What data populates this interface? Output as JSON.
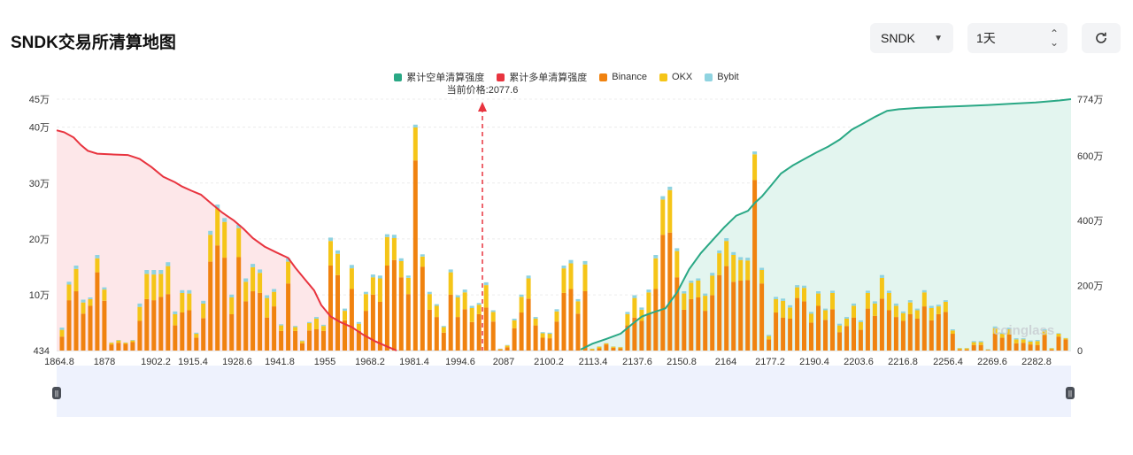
{
  "header": {
    "title": "SNDK交易所清算地图"
  },
  "controls": {
    "symbol": "SNDK",
    "interval": "1天",
    "symbol_icon": "chevron-down-icon",
    "interval_icon": "up-down-icon",
    "refresh_icon": "refresh-icon"
  },
  "colors": {
    "short_cum": "#2aa885",
    "long_cum": "#e8343f",
    "binance": "#f0820f",
    "okx": "#f5c518",
    "bybit": "#8fd3e0",
    "short_fill": "#e3f5ef",
    "long_fill": "#fde7e9"
  },
  "chart_data": {
    "type": "bar",
    "legend": [
      {
        "label": "累计空单清算强度",
        "color": "#2aa885"
      },
      {
        "label": "累计多单清算强度",
        "color": "#e8343f"
      },
      {
        "label": "Binance",
        "color": "#f0820f"
      },
      {
        "label": "OKX",
        "color": "#f5c518"
      },
      {
        "label": "Bybit",
        "color": "#8fd3e0"
      }
    ],
    "current_price_label": "当前价格:2077.6",
    "current_price": 2077.6,
    "watermark": "coinglass",
    "x_ticks": [
      "1864.8",
      "1878",
      "1902.2",
      "1915.4",
      "1928.6",
      "1941.8",
      "1955",
      "1968.2",
      "1981.4",
      "1994.6",
      "2087",
      "2100.2",
      "2113.4",
      "2137.6",
      "2150.8",
      "2164",
      "2177.2",
      "2190.4",
      "2203.6",
      "2216.8",
      "2256.4",
      "2269.6",
      "2282.8"
    ],
    "y_left_ticks": [
      "434",
      "10万",
      "20万",
      "30万",
      "40万",
      "45万"
    ],
    "y_left_values": [
      434,
      100000,
      200000,
      300000,
      400000,
      450000
    ],
    "y_right_ticks": [
      "0",
      "200万",
      "400万",
      "600万",
      "774万"
    ],
    "y_right_values": [
      0,
      2000000,
      4000000,
      6000000,
      7740000
    ],
    "y_left_range": [
      434,
      450000
    ],
    "y_right_range": [
      0,
      7740000
    ],
    "bars": {
      "binance": [
        25000,
        90000,
        106000,
        66000,
        80000,
        140000,
        89000,
        11000,
        14000,
        12000,
        15000,
        53000,
        92000,
        90000,
        96000,
        101000,
        45000,
        68000,
        72000,
        23000,
        58000,
        159000,
        188000,
        166000,
        65000,
        167000,
        88000,
        106000,
        103000,
        59000,
        79000,
        35000,
        120000,
        35000,
        13000,
        36000,
        38000,
        35000,
        152000,
        135000,
        54000,
        110000,
        35000,
        71000,
        100000,
        87000,
        152000,
        162000,
        131000,
        101000,
        340000,
        150000,
        73000,
        60000,
        32000,
        100000,
        60000,
        74000,
        51000,
        65000,
        77000,
        52000,
        2000,
        6000,
        40000,
        68000,
        93000,
        45000,
        23000,
        22000,
        52000,
        103000,
        110000,
        66000,
        106000,
        1000,
        4000,
        11000,
        5000,
        4000,
        45000,
        59000,
        53000,
        67000,
        110000,
        207000,
        211000,
        131000,
        73000,
        92000,
        95000,
        71000,
        99000,
        135000,
        151000,
        123000,
        125000,
        126000,
        305000,
        120000,
        20000,
        68000,
        59000,
        57000,
        94000,
        88000,
        50000,
        80000,
        55000,
        74000,
        33000,
        44000,
        59000,
        37000,
        75000,
        62000,
        93000,
        72000,
        60000,
        53000,
        65000,
        57000,
        79000,
        54000,
        65000,
        69000,
        30000,
        2000,
        2000,
        10000,
        10000,
        1000,
        30000,
        23000,
        29000,
        13000,
        14000,
        11000,
        10000,
        28000,
        2000,
        25000,
        20000
      ],
      "okx": [
        12000,
        28000,
        40000,
        20000,
        12000,
        25000,
        20000,
        3000,
        4000,
        2000,
        3000,
        25000,
        45000,
        46000,
        41000,
        50000,
        20000,
        35000,
        30000,
        7000,
        26000,
        48000,
        66000,
        64000,
        30000,
        52000,
        35000,
        43000,
        36000,
        35000,
        26000,
        10000,
        39000,
        7000,
        4000,
        13000,
        19000,
        9000,
        44000,
        38000,
        17000,
        37000,
        13000,
        30000,
        31000,
        42000,
        51000,
        39000,
        29000,
        29000,
        59000,
        18000,
        28000,
        20000,
        10000,
        40000,
        35000,
        30000,
        25000,
        17000,
        40000,
        17000,
        1000,
        3000,
        14000,
        28000,
        36000,
        12000,
        8000,
        8000,
        18000,
        44000,
        46000,
        22000,
        48000,
        2000,
        3000,
        2000,
        2000,
        2000,
        20000,
        35000,
        20000,
        37000,
        55000,
        63000,
        76000,
        47000,
        29000,
        29000,
        30000,
        27000,
        35000,
        39000,
        45000,
        48000,
        37000,
        35000,
        46000,
        24000,
        6000,
        24000,
        30000,
        20000,
        19000,
        24000,
        16000,
        22000,
        17000,
        29000,
        12000,
        13000,
        21000,
        14000,
        28000,
        22000,
        37000,
        31000,
        20000,
        14000,
        21000,
        15000,
        25000,
        22000,
        14000,
        18000,
        6000,
        2000,
        2000,
        5000,
        5000,
        1000,
        10000,
        7000,
        9000,
        7000,
        6000,
        5000,
        7000,
        8000,
        2000,
        5000,
        2000
      ],
      "bybit": [
        4000,
        5000,
        6000,
        5000,
        3000,
        6000,
        4000,
        500,
        1000,
        500,
        1000,
        6000,
        7000,
        8000,
        7000,
        7000,
        5000,
        5000,
        6000,
        2000,
        5000,
        7000,
        7000,
        7000,
        5000,
        6000,
        6000,
        6000,
        6000,
        5000,
        5000,
        2000,
        6000,
        2000,
        1000,
        2000,
        3000,
        2000,
        6000,
        6000,
        4000,
        6000,
        3000,
        4000,
        5000,
        5000,
        5000,
        6000,
        5000,
        4000,
        5000,
        4000,
        4000,
        3000,
        2000,
        5000,
        4000,
        5000,
        4000,
        3000,
        5000,
        3000,
        500,
        1000,
        3000,
        4000,
        5000,
        3000,
        2000,
        2000,
        4000,
        5000,
        6000,
        4000,
        6000,
        500,
        500,
        500,
        500,
        500,
        4000,
        5000,
        4000,
        5000,
        6000,
        6000,
        6000,
        5000,
        4000,
        4000,
        4000,
        4000,
        5000,
        5000,
        5000,
        5000,
        5000,
        5000,
        5000,
        4000,
        2000,
        4000,
        4000,
        4000,
        4000,
        4000,
        3000,
        4000,
        3000,
        4000,
        3000,
        3000,
        4000,
        3000,
        4000,
        4000,
        5000,
        4000,
        4000,
        3000,
        4000,
        3000,
        4000,
        4000,
        3000,
        3000,
        2000,
        500,
        500,
        2000,
        2000,
        500,
        3000,
        2000,
        3000,
        2000,
        2000,
        2000,
        2000,
        2000,
        500,
        1000,
        500
      ]
    },
    "long_cumulative": {
      "x_start": 1864.8,
      "x_end": 2077.6,
      "points": [
        [
          1864.8,
          6780000
        ],
        [
          1868,
          6720000
        ],
        [
          1872,
          6560000
        ],
        [
          1875,
          6330000
        ],
        [
          1878,
          6150000
        ],
        [
          1882,
          6060000
        ],
        [
          1888,
          6040000
        ],
        [
          1895,
          6020000
        ],
        [
          1900,
          5900000
        ],
        [
          1905,
          5650000
        ],
        [
          1910,
          5350000
        ],
        [
          1915,
          5180000
        ],
        [
          1918,
          5050000
        ],
        [
          1922,
          4920000
        ],
        [
          1926,
          4800000
        ],
        [
          1930,
          4550000
        ],
        [
          1935,
          4250000
        ],
        [
          1940,
          4000000
        ],
        [
          1944,
          3750000
        ],
        [
          1948,
          3460000
        ],
        [
          1953,
          3200000
        ],
        [
          1958,
          3020000
        ],
        [
          1963,
          2850000
        ],
        [
          1966,
          2550000
        ],
        [
          1970,
          2200000
        ],
        [
          1974,
          1850000
        ],
        [
          1977,
          1400000
        ],
        [
          1981,
          1050000
        ],
        [
          1985,
          880000
        ],
        [
          1990,
          720000
        ],
        [
          1995,
          480000
        ],
        [
          2000,
          280000
        ],
        [
          2005,
          120000
        ],
        [
          2009,
          0
        ]
      ]
    },
    "short_cumulative": {
      "points": [
        [
          2087,
          30000
        ],
        [
          2092,
          210000
        ],
        [
          2098,
          360000
        ],
        [
          2104,
          520000
        ],
        [
          2109,
          820000
        ],
        [
          2113,
          1050000
        ],
        [
          2118,
          1180000
        ],
        [
          2123,
          1300000
        ],
        [
          2128,
          1800000
        ],
        [
          2133,
          2500000
        ],
        [
          2138,
          3000000
        ],
        [
          2143,
          3400000
        ],
        [
          2148,
          3800000
        ],
        [
          2153,
          4150000
        ],
        [
          2158,
          4300000
        ],
        [
          2161,
          4550000
        ],
        [
          2164,
          4750000
        ],
        [
          2168,
          5100000
        ],
        [
          2172,
          5450000
        ],
        [
          2177,
          5700000
        ],
        [
          2182,
          5900000
        ],
        [
          2187,
          6100000
        ],
        [
          2192,
          6280000
        ],
        [
          2197,
          6500000
        ],
        [
          2202,
          6800000
        ],
        [
          2207,
          7000000
        ],
        [
          2212,
          7200000
        ],
        [
          2217,
          7380000
        ],
        [
          2222,
          7430000
        ],
        [
          2230,
          7470000
        ],
        [
          2240,
          7500000
        ],
        [
          2250,
          7530000
        ],
        [
          2260,
          7560000
        ],
        [
          2270,
          7600000
        ],
        [
          2280,
          7640000
        ],
        [
          2290,
          7700000
        ],
        [
          2295,
          7740000
        ]
      ]
    }
  }
}
